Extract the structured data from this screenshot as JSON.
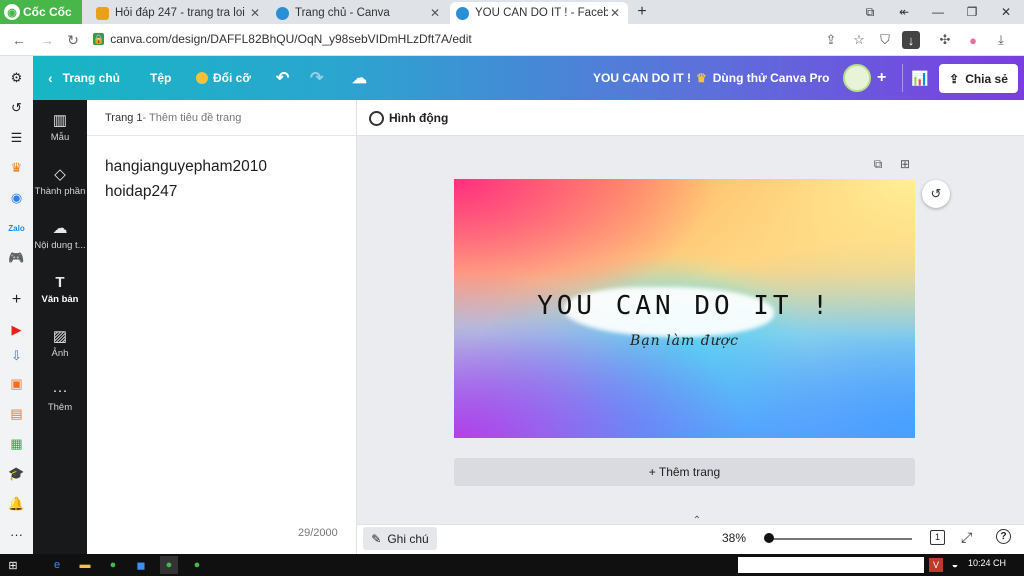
{
  "browser": {
    "brand": "Cốc Cốc",
    "tabs": [
      {
        "title": "Hỏi đáp 247 - trang tra loi",
        "active": false,
        "favicon_color": "#e8a21a"
      },
      {
        "title": "Trang chủ - Canva",
        "active": false,
        "favicon_color": "#2b8fd6"
      },
      {
        "title": "YOU CAN DO IT ! - Facebook",
        "active": true,
        "favicon_color": "#2b8fd6"
      }
    ],
    "url": "canva.com/design/DAFFL82BhQU/OqN_y98sebVIDmHLzDft7A/edit"
  },
  "canva_header": {
    "home": "Trang chủ",
    "file": "Tệp",
    "resize": "Đổi cỡ",
    "design_title": "YOU CAN DO IT !",
    "try_pro": "Dùng thử Canva Pro",
    "share": "Chia sẻ"
  },
  "rail": [
    {
      "label": "Mẫu",
      "icon": "template-icon"
    },
    {
      "label": "Thành phần",
      "icon": "elements-icon"
    },
    {
      "label": "Nội dung t...",
      "icon": "upload-icon"
    },
    {
      "label": "Văn bản",
      "icon": "text-icon"
    },
    {
      "label": "Ảnh",
      "icon": "photo-icon"
    },
    {
      "label": "Thêm",
      "icon": "more-icon"
    }
  ],
  "notes_panel": {
    "page": "Trang 1",
    "page_title_placeholder": " - Thêm tiêu đề trang",
    "lines": [
      "hangianguyepham2010",
      "hoidap247"
    ],
    "char_count": "29/2000"
  },
  "editor": {
    "animate": "Hình động",
    "headline": "YOU CAN DO IT !",
    "subline": "Bạn làm được",
    "add_page": "+ Thêm trang",
    "notes": "Ghi chú",
    "zoom": "38%",
    "zoom_level_fraction": 0.38,
    "page_count": "1"
  },
  "taskbar": {
    "time": "10:24 CH"
  },
  "colors": {
    "header_start": "#17b6c4",
    "header_end": "#7b3de0",
    "rail": "#18191b",
    "browser_brand": "#48b749"
  }
}
